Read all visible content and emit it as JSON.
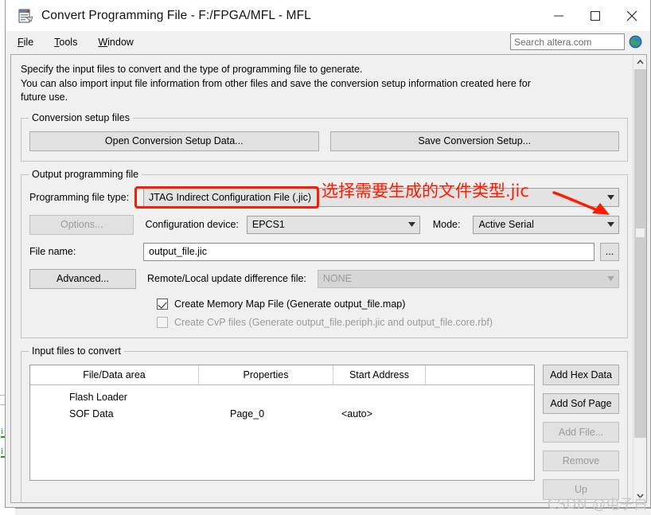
{
  "window": {
    "title": "Convert Programming File - F:/FPGA/MFL - MFL",
    "app_icon": "convert-file-icon",
    "minimize_label": "Minimize",
    "maximize_label": "Maximize",
    "close_label": "Close"
  },
  "menubar": {
    "items": [
      {
        "label": "File",
        "mnemonic": "F"
      },
      {
        "label": "Tools",
        "mnemonic": "T"
      },
      {
        "label": "Window",
        "mnemonic": "W"
      }
    ],
    "search": {
      "placeholder": "Search altera.com",
      "value": "",
      "icon": "globe-icon"
    }
  },
  "intro": {
    "line1": "Specify the input files to convert and the type of programming file to generate.",
    "line2": "You can also import input file information from other files and save the conversion setup information created here for",
    "line3": "future use."
  },
  "conversion_setup": {
    "legend": "Conversion setup files",
    "open_button": "Open Conversion Setup Data...",
    "save_button": "Save Conversion Setup..."
  },
  "output_file": {
    "legend": "Output programming file",
    "file_type_label": "Programming file type:",
    "file_type_value": "JTAG Indirect Configuration File (.jic)",
    "options_button": "Options...",
    "options_mnemonic": "O",
    "config_device_label": "Configuration device:",
    "config_device_value": "EPCS1",
    "config_device_mnemonic": "g",
    "mode_label": "Mode:",
    "mode_mnemonic": "M",
    "mode_value": "Active Serial",
    "file_name_label": "File name:",
    "file_name_mnemonic": "n",
    "file_name_value": "output_file.jic",
    "browse_button": "...",
    "advanced_button": "Advanced...",
    "remote_local_label": "Remote/Local update difference file:",
    "remote_local_mnemonic": "L",
    "remote_local_value": "NONE",
    "memory_map_checkbox": "Create Memory Map File (Generate output_file.map)",
    "memory_map_checked": true,
    "cvp_checkbox": "Create CvP files (Generate output_file.periph.jic and output_file.core.rbf)",
    "cvp_checked": false
  },
  "input_files": {
    "legend": "Input files to convert",
    "columns": [
      "File/Data area",
      "Properties",
      "Start Address"
    ],
    "rows": [
      {
        "area": "Flash Loader",
        "properties": "",
        "start_address": ""
      },
      {
        "area": "SOF Data",
        "properties": "Page_0",
        "start_address": "<auto>"
      }
    ],
    "buttons": [
      {
        "label": "Add Hex Data",
        "mnemonic": "x",
        "enabled": true
      },
      {
        "label": "Add Sof Page",
        "mnemonic": "S",
        "enabled": true
      },
      {
        "label": "Add File...",
        "mnemonic": "F",
        "enabled": false
      },
      {
        "label": "Remove",
        "mnemonic": "",
        "enabled": false
      },
      {
        "label": "Up",
        "mnemonic": "",
        "enabled": false
      }
    ]
  },
  "annotation": {
    "text": "选择需要生成的文件类型.jic",
    "color": "#ff1a00",
    "highlight_target": "programming-file-type-combo"
  },
  "watermark": {
    "text": "CSDN @电子白"
  }
}
